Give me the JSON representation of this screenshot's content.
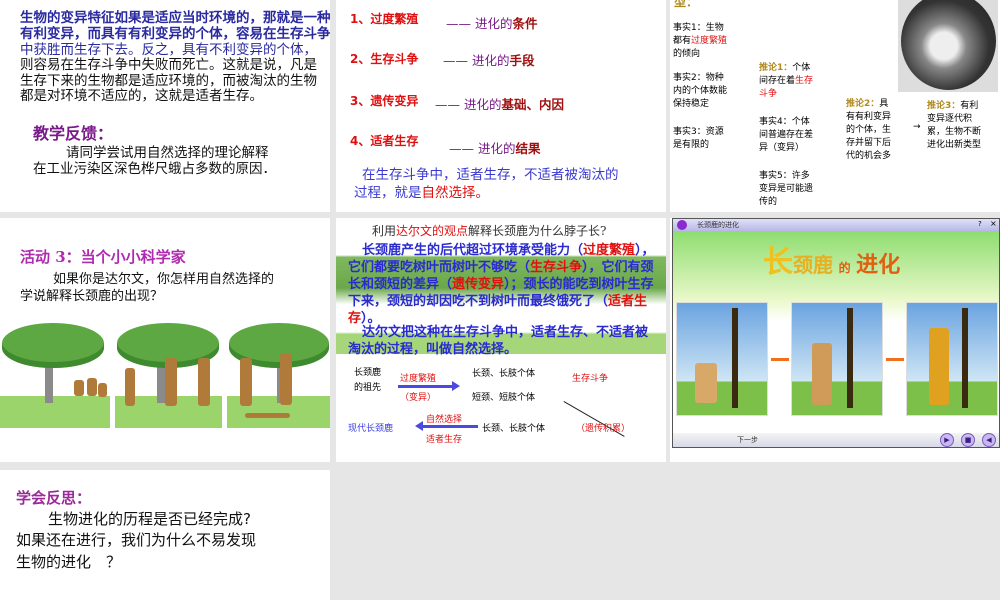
{
  "slide1": {
    "lines": [
      "生物的变异特征如果是适应当时环境的，那就是一种",
      "有利变异，而具有有利变异的个体，容易在生存斗争",
      "中获胜而生存下去。反之，具有不利变异的个体，",
      "则容易在生存斗争中失败而死亡。这就是说，凡是",
      "生存下来的生物都是适应环境的，而被淘汰的生物",
      "都是对环境不适应的，这就是适者生存。"
    ],
    "feedback_title": "教学反馈：",
    "feedback_lines": [
      "请同学尝试用自然选择的理论解释",
      "在工业污染区深色桦尺蛾占多数的原因．"
    ]
  },
  "slide2": {
    "items": [
      {
        "num": "1、过度繁殖",
        "dash": "——",
        "pre": "进化的",
        "key": "条件"
      },
      {
        "num": "2、生存斗争",
        "dash": "——",
        "pre": "进化的",
        "key": "手段"
      },
      {
        "num": "3、遗传变异",
        "dash": "——",
        "pre": "进化的",
        "key": "基础、内因"
      },
      {
        "num": "4、适者生存",
        "dash": "——",
        "pre": "进化的",
        "key": "结果"
      }
    ],
    "summary_1": "在生存斗争中，适者生存，不适者被淘汰的",
    "summary_2": "过程，就是",
    "summary_key": "自然选择。"
  },
  "slide3": {
    "title": "型：",
    "fact1": [
      "事实1：生物",
      "都有",
      "过度繁殖",
      "的倾向"
    ],
    "fact2": [
      "事实2：物种",
      "内的个体数能",
      "保持稳定"
    ],
    "fact3": [
      "事实3：资源",
      "是有限的"
    ],
    "inf1": [
      "推论1：",
      "个体",
      "间存在着",
      "生存",
      "斗争"
    ],
    "fact4": [
      "事实4：个体",
      "间普遍存在差",
      "异（变异）"
    ],
    "fact5": [
      "事实5：许多",
      "变异是可能遗",
      "传的"
    ],
    "inf2": [
      "推论2：",
      "具",
      "有有利变异",
      "的个体，生",
      "存并留下后",
      "代的机会多"
    ],
    "arrow": "→",
    "inf3": [
      "推论3：",
      "有利",
      "变异逐代积",
      "累，生物不断",
      "进化出新类型"
    ]
  },
  "slide4": {
    "title": "活动 3：当个小小科学家",
    "lines": [
      "如果你是达尔文，你怎样用自然选择的",
      "学说解释长颈鹿的出现？"
    ]
  },
  "slide5": {
    "question_pre": "利用",
    "question_key": "达尔文的观点",
    "question_post": "解释长颈鹿为什么脖子长?",
    "para1": [
      "长颈鹿产生的后代超过环境承受能力（",
      "过度繁殖",
      "），它们都要吃树叶而树叶不够吃（",
      "生存斗争",
      "），它们有颈长和颈短的差异（",
      "遗传变异",
      "）；颈长的能吃到树叶生存下来，颈短的却因吃不到树叶而最终饿死了（",
      "适者生存",
      "）。"
    ],
    "para2": "达尔文把这种在生存斗争中，适者生存、不适者被淘汰的过程，叫做自然选择。",
    "diagram": {
      "ancestor": [
        "长颈鹿",
        "的祖先"
      ],
      "overbreed": "过度繁殖",
      "variation": "（变异）",
      "long": "长颈、长肢个体",
      "short": "短颈、短肢个体",
      "struggle": "生存斗争",
      "modern": "现代长颈鹿",
      "natsel": "自然选择",
      "survival": "适者生存",
      "long2": "长颈、长肢个体",
      "accum": "（遗传积累）"
    }
  },
  "slide6": {
    "window_title": "长颈鹿的进化",
    "help": "?",
    "close": "×",
    "heading": [
      "长",
      "颈",
      "鹿",
      "的",
      "进",
      "化"
    ],
    "next": "下一步"
  },
  "slide7": {
    "title": "学会反思：",
    "lines": [
      "生物进化的历程是否已经完成?",
      "如果还在进行，我们为什么不易发现",
      "生物的进化　？"
    ]
  }
}
